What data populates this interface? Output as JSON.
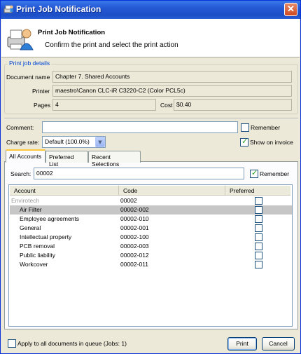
{
  "window": {
    "title": "Print Job Notification",
    "close_glyph": "✕",
    "title_icon": "printer-user-icon"
  },
  "header": {
    "title": "Print Job Notification",
    "subtitle": "Confirm the print and select the print action",
    "icon": "printer-user-icon"
  },
  "details": {
    "legend": "Print job details",
    "document_name_label": "Document name",
    "document_name": "Chapter 7. Shared Accounts",
    "printer_label": "Printer",
    "printer": "maestro\\Canon CLC-iR C3220-C2 (Color PCL5c)",
    "pages_label": "Pages",
    "pages": "4",
    "cost_label": "Cost",
    "cost": "$0.40"
  },
  "comment": {
    "label": "Comment:",
    "value": "",
    "remember_label": "Remember",
    "remember_checked": false
  },
  "charge": {
    "label": "Charge rate:",
    "selected": "Default (100.0%)",
    "show_on_invoice_label": "Show on invoice",
    "show_on_invoice_checked": true
  },
  "tabs": [
    {
      "label": "All Accounts",
      "active": true
    },
    {
      "label": "Preferred List",
      "active": false
    },
    {
      "label": "Recent Selections",
      "active": false
    }
  ],
  "search": {
    "label": "Search:",
    "value": "00002",
    "remember_label": "Remember",
    "remember_checked": true
  },
  "list": {
    "columns": [
      "Account",
      "Code",
      "Preferred"
    ],
    "rows": [
      {
        "account": "Envirotech",
        "code": "00002",
        "parent": true,
        "selected": false,
        "preferred": false
      },
      {
        "account": "Air Filter",
        "code": "00002-002",
        "parent": false,
        "selected": true,
        "preferred": false
      },
      {
        "account": "Employee agreements",
        "code": "00002-010",
        "parent": false,
        "selected": false,
        "preferred": false
      },
      {
        "account": "General",
        "code": "00002-001",
        "parent": false,
        "selected": false,
        "preferred": false
      },
      {
        "account": "Intellectual property",
        "code": "00002-100",
        "parent": false,
        "selected": false,
        "preferred": false
      },
      {
        "account": "PCB removal",
        "code": "00002-003",
        "parent": false,
        "selected": false,
        "preferred": false
      },
      {
        "account": "Public liability",
        "code": "00002-012",
        "parent": false,
        "selected": false,
        "preferred": false
      },
      {
        "account": "Workcover",
        "code": "00002-011",
        "parent": false,
        "selected": false,
        "preferred": false
      }
    ]
  },
  "footer": {
    "apply_all_label": "Apply to all documents in queue (Jobs: 1)",
    "apply_all_checked": false,
    "print_label": "Print",
    "cancel_label": "Cancel"
  },
  "colors": {
    "title_bar": "#2458d4",
    "legend": "#0046d5",
    "selection": "#c6c6c6",
    "close": "#d04a20"
  }
}
